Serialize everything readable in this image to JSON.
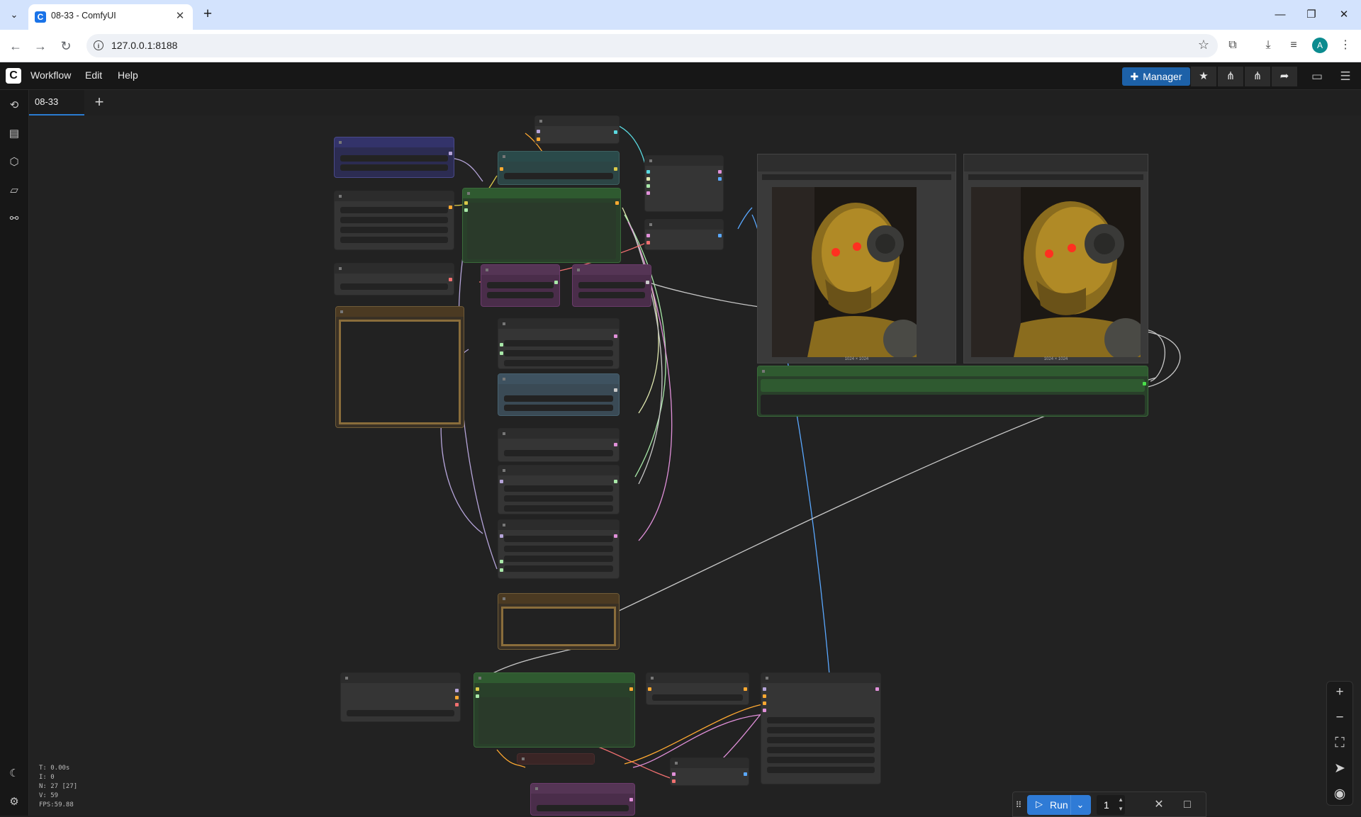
{
  "browser": {
    "tab_title": "08-33 - ComfyUI",
    "url": "127.0.0.1:8188",
    "avatar_letter": "A"
  },
  "menubar": {
    "logo": "C",
    "items": [
      "Workflow",
      "Edit",
      "Help"
    ],
    "manager_label": "Manager"
  },
  "workflow_tabs": {
    "active": "08-33",
    "add_label": "+"
  },
  "previews": [
    {
      "size_label": "1024 × 1024"
    },
    {
      "size_label": "1024 × 1024"
    }
  ],
  "stats": {
    "t": "T: 0.00s",
    "i": "I: 0",
    "n": "N: 27 [27]",
    "v": "V: 59",
    "fps": "FPS:59.88"
  },
  "runbar": {
    "run_label": "Run",
    "count": "1"
  },
  "colors": {
    "accent": "#2f7bd6",
    "manager": "#1d61a8",
    "canvas": "#222222"
  }
}
